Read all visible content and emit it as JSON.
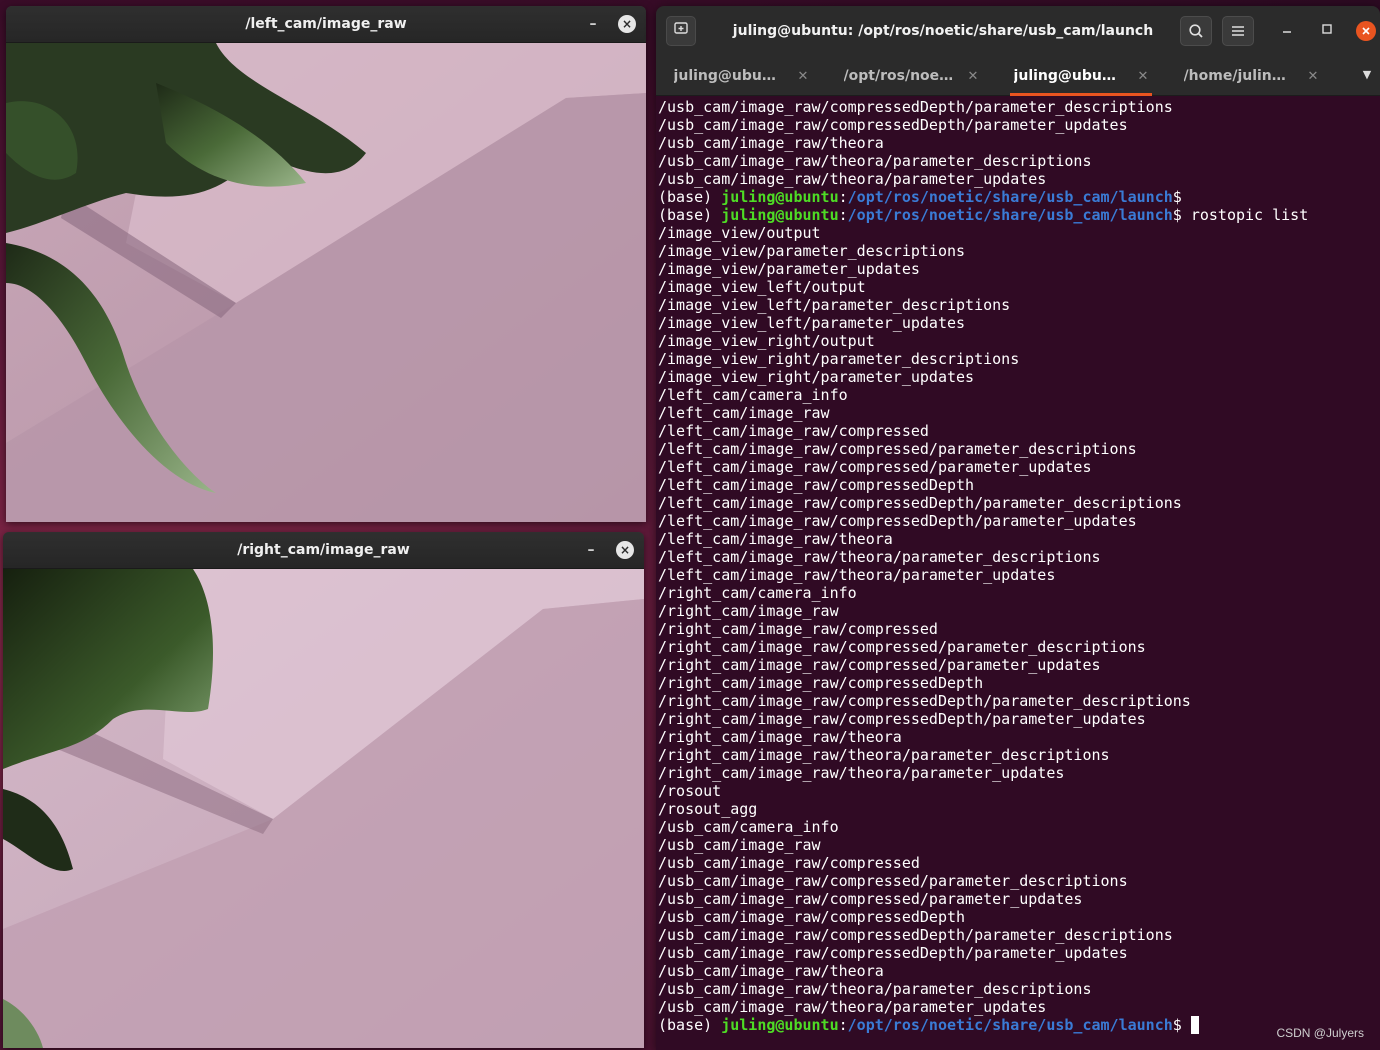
{
  "left_viewer": {
    "title": "/left_cam/image_raw",
    "minimize_glyph": "–",
    "close_glyph": "×",
    "image_description_icon": "camera-frame"
  },
  "right_viewer": {
    "title": "/right_cam/image_raw",
    "minimize_glyph": "–",
    "close_glyph": "×",
    "image_description_icon": "camera-frame"
  },
  "terminal": {
    "title": "juling@ubuntu: /opt/ros/noetic/share/usb_cam/launch",
    "tabs": [
      {
        "label": "juling@ubun...",
        "active": false
      },
      {
        "label": "/opt/ros/noe...",
        "active": false
      },
      {
        "label": "juling@ubun...",
        "active": true
      },
      {
        "label": "/home/juling...",
        "active": false
      }
    ],
    "icons": {
      "new_tab": "new-tab-icon",
      "search": "search-icon",
      "menu": "hamburger-menu-icon",
      "minimize": "minimize-icon",
      "maximize": "maximize-icon",
      "close": "close-icon",
      "tab_overflow": "chevron-down-icon"
    },
    "prompt": {
      "prefix": "(base) ",
      "user_host": "juling@ubuntu",
      "colon": ":",
      "path": "/opt/ros/noetic/share/usb_cam/launch",
      "dollar": "$"
    },
    "lines": [
      {
        "type": "out",
        "text": "/usb_cam/image_raw/compressedDepth/parameter_descriptions"
      },
      {
        "type": "out",
        "text": "/usb_cam/image_raw/compressedDepth/parameter_updates"
      },
      {
        "type": "out",
        "text": "/usb_cam/image_raw/theora"
      },
      {
        "type": "out",
        "text": "/usb_cam/image_raw/theora/parameter_descriptions"
      },
      {
        "type": "out",
        "text": "/usb_cam/image_raw/theora/parameter_updates"
      },
      {
        "type": "prompt",
        "cmd": ""
      },
      {
        "type": "prompt",
        "cmd": " rostopic list"
      },
      {
        "type": "out",
        "text": "/image_view/output"
      },
      {
        "type": "out",
        "text": "/image_view/parameter_descriptions"
      },
      {
        "type": "out",
        "text": "/image_view/parameter_updates"
      },
      {
        "type": "out",
        "text": "/image_view_left/output"
      },
      {
        "type": "out",
        "text": "/image_view_left/parameter_descriptions"
      },
      {
        "type": "out",
        "text": "/image_view_left/parameter_updates"
      },
      {
        "type": "out",
        "text": "/image_view_right/output"
      },
      {
        "type": "out",
        "text": "/image_view_right/parameter_descriptions"
      },
      {
        "type": "out",
        "text": "/image_view_right/parameter_updates"
      },
      {
        "type": "out",
        "text": "/left_cam/camera_info"
      },
      {
        "type": "out",
        "text": "/left_cam/image_raw"
      },
      {
        "type": "out",
        "text": "/left_cam/image_raw/compressed"
      },
      {
        "type": "out",
        "text": "/left_cam/image_raw/compressed/parameter_descriptions"
      },
      {
        "type": "out",
        "text": "/left_cam/image_raw/compressed/parameter_updates"
      },
      {
        "type": "out",
        "text": "/left_cam/image_raw/compressedDepth"
      },
      {
        "type": "out",
        "text": "/left_cam/image_raw/compressedDepth/parameter_descriptions"
      },
      {
        "type": "out",
        "text": "/left_cam/image_raw/compressedDepth/parameter_updates"
      },
      {
        "type": "out",
        "text": "/left_cam/image_raw/theora"
      },
      {
        "type": "out",
        "text": "/left_cam/image_raw/theora/parameter_descriptions"
      },
      {
        "type": "out",
        "text": "/left_cam/image_raw/theora/parameter_updates"
      },
      {
        "type": "out",
        "text": "/right_cam/camera_info"
      },
      {
        "type": "out",
        "text": "/right_cam/image_raw"
      },
      {
        "type": "out",
        "text": "/right_cam/image_raw/compressed"
      },
      {
        "type": "out",
        "text": "/right_cam/image_raw/compressed/parameter_descriptions"
      },
      {
        "type": "out",
        "text": "/right_cam/image_raw/compressed/parameter_updates"
      },
      {
        "type": "out",
        "text": "/right_cam/image_raw/compressedDepth"
      },
      {
        "type": "out",
        "text": "/right_cam/image_raw/compressedDepth/parameter_descriptions"
      },
      {
        "type": "out",
        "text": "/right_cam/image_raw/compressedDepth/parameter_updates"
      },
      {
        "type": "out",
        "text": "/right_cam/image_raw/theora"
      },
      {
        "type": "out",
        "text": "/right_cam/image_raw/theora/parameter_descriptions"
      },
      {
        "type": "out",
        "text": "/right_cam/image_raw/theora/parameter_updates"
      },
      {
        "type": "out",
        "text": "/rosout"
      },
      {
        "type": "out",
        "text": "/rosout_agg"
      },
      {
        "type": "out",
        "text": "/usb_cam/camera_info"
      },
      {
        "type": "out",
        "text": "/usb_cam/image_raw"
      },
      {
        "type": "out",
        "text": "/usb_cam/image_raw/compressed"
      },
      {
        "type": "out",
        "text": "/usb_cam/image_raw/compressed/parameter_descriptions"
      },
      {
        "type": "out",
        "text": "/usb_cam/image_raw/compressed/parameter_updates"
      },
      {
        "type": "out",
        "text": "/usb_cam/image_raw/compressedDepth"
      },
      {
        "type": "out",
        "text": "/usb_cam/image_raw/compressedDepth/parameter_descriptions"
      },
      {
        "type": "out",
        "text": "/usb_cam/image_raw/compressedDepth/parameter_updates"
      },
      {
        "type": "out",
        "text": "/usb_cam/image_raw/theora"
      },
      {
        "type": "out",
        "text": "/usb_cam/image_raw/theora/parameter_descriptions"
      },
      {
        "type": "out",
        "text": "/usb_cam/image_raw/theora/parameter_updates"
      },
      {
        "type": "prompt_cursor",
        "cmd": " "
      }
    ]
  },
  "watermark": "CSDN @Julyers",
  "colors": {
    "terminal_bg": "#300a24",
    "prompt_user": "#4edc25",
    "prompt_path": "#3a7bd5",
    "accent": "#e95420"
  }
}
